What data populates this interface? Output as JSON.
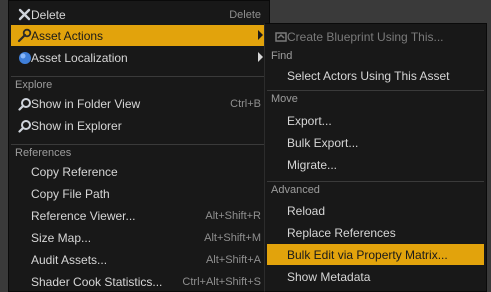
{
  "main_menu": {
    "delete": {
      "label": "Delete",
      "shortcut": "Delete",
      "icon": "close-x-icon"
    },
    "asset_actions": {
      "label": "Asset Actions",
      "icon": "wrench-icon"
    },
    "asset_localization": {
      "label": "Asset Localization",
      "icon": "globe-icon"
    },
    "explore_header": "Explore",
    "show_in_folder_view": {
      "label": "Show in Folder View",
      "shortcut": "Ctrl+B",
      "icon": "magnifier-icon"
    },
    "show_in_explorer": {
      "label": "Show in Explorer",
      "icon": "magnifier-icon"
    },
    "references_header": "References",
    "copy_reference": "Copy Reference",
    "copy_file_path": "Copy File Path",
    "reference_viewer": {
      "label": "Reference Viewer...",
      "shortcut": "Alt+Shift+R"
    },
    "size_map": {
      "label": "Size Map...",
      "shortcut": "Alt+Shift+M"
    },
    "audit_assets": {
      "label": "Audit Assets...",
      "shortcut": "Alt+Shift+A"
    },
    "shader_cook_statistics": {
      "label": "Shader Cook Statistics...",
      "shortcut": "Ctrl+Alt+Shift+S"
    }
  },
  "sub_menu": {
    "create_blueprint": {
      "label": "Create Blueprint Using This...",
      "icon": "blueprint-icon"
    },
    "find_header": "Find",
    "select_actors": "Select Actors Using This Asset",
    "move_header": "Move",
    "export": "Export...",
    "bulk_export": "Bulk Export...",
    "migrate": "Migrate...",
    "advanced_header": "Advanced",
    "reload": "Reload",
    "replace_references": "Replace References",
    "bulk_edit": "Bulk Edit via Property Matrix...",
    "show_metadata": "Show Metadata"
  },
  "colors": {
    "highlight": "#e2a30c",
    "menu_bg": "#181818",
    "backdrop": "#3a3a3a"
  }
}
